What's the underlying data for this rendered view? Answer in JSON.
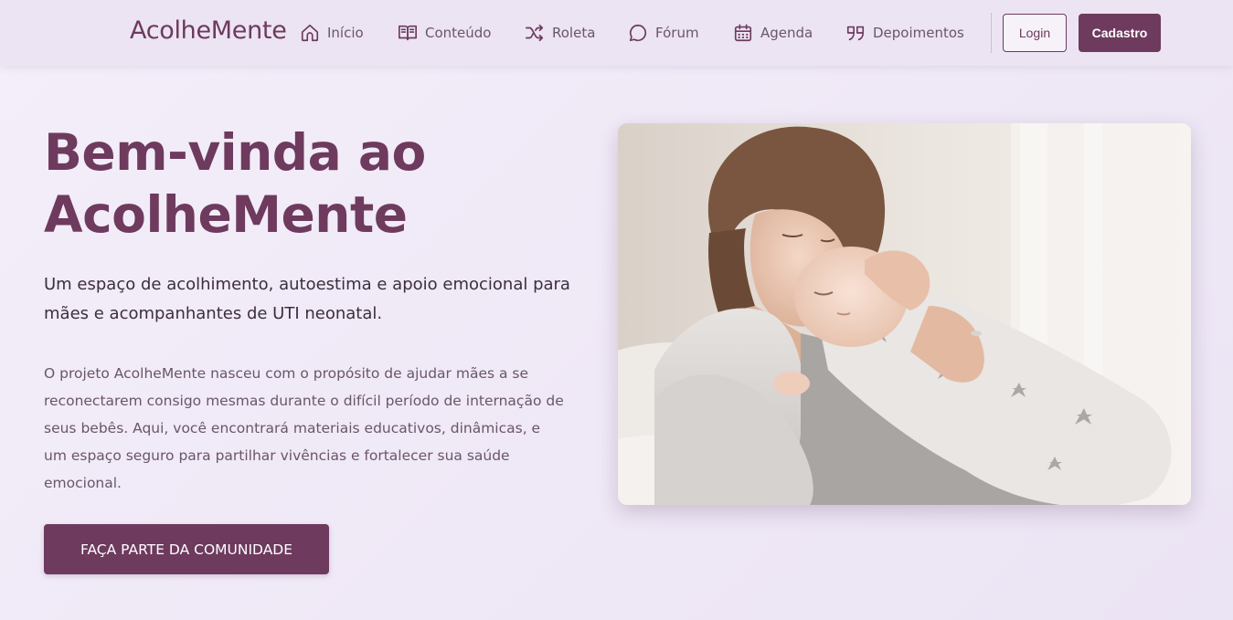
{
  "brand": "AcolheMente",
  "nav": {
    "items": [
      {
        "label": "Início",
        "icon": "home-icon"
      },
      {
        "label": "Conteúdo",
        "icon": "book-open-icon"
      },
      {
        "label": "Roleta",
        "icon": "shuffle-icon"
      },
      {
        "label": "Fórum",
        "icon": "chat-bubble-icon"
      },
      {
        "label": "Agenda",
        "icon": "calendar-icon"
      },
      {
        "label": "Depoimentos",
        "icon": "quote-icon"
      }
    ],
    "login_label": "Login",
    "signup_label": "Cadastro"
  },
  "hero": {
    "title_line1": "Bem-vinda ao",
    "title_line2": "AcolheMente",
    "subtitle": "Um espaço de acolhimento, autoestima e apoio emocional para mães e acompanhantes de UTI neonatal.",
    "body": "O projeto AcolheMente nasceu com o propósito de ajudar mães a se reconectarem consigo mesmas durante o difícil período de internação de seus bebês. Aqui, você encontrará materiais educativos, dinâmicas, e um espaço seguro para partilhar vivências e fortalecer sua saúde emocional.",
    "cta_label": "FAÇA PARTE DA COMUNIDADE"
  },
  "colors": {
    "brand": "#6e3a5e",
    "background": "#f1ebf7",
    "navbar": "#ece4f3"
  }
}
